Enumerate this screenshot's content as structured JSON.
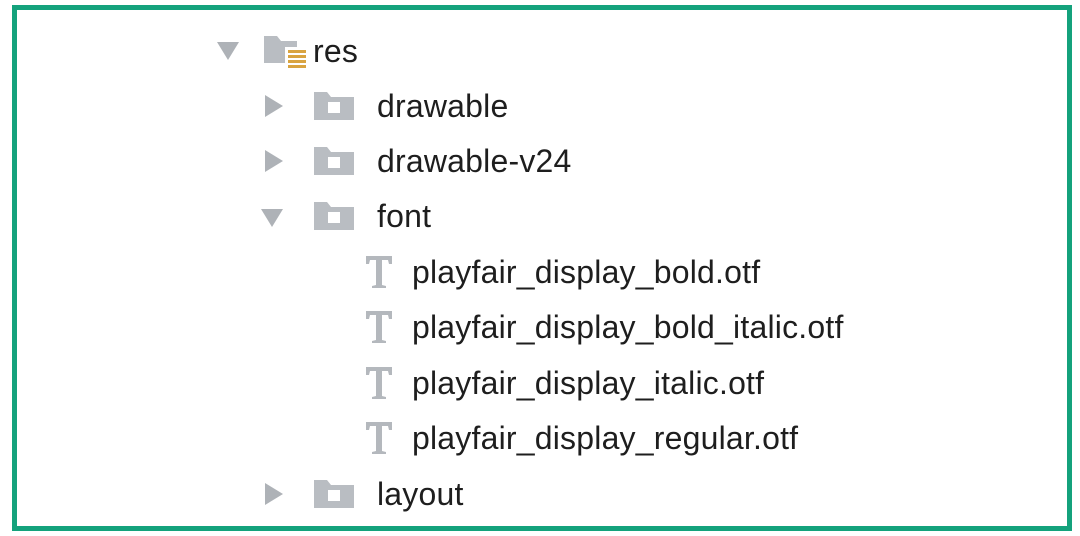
{
  "tree": {
    "root": {
      "label": "res",
      "expanded": true
    },
    "children": [
      {
        "label": "drawable",
        "expanded": false,
        "kind": "folder"
      },
      {
        "label": "drawable-v24",
        "expanded": false,
        "kind": "folder"
      },
      {
        "label": "font",
        "expanded": true,
        "kind": "folder",
        "children": [
          {
            "label": "playfair_display_bold.otf",
            "kind": "font-file"
          },
          {
            "label": "playfair_display_bold_italic.otf",
            "kind": "font-file"
          },
          {
            "label": "playfair_display_italic.otf",
            "kind": "font-file"
          },
          {
            "label": "playfair_display_regular.otf",
            "kind": "font-file"
          }
        ]
      },
      {
        "label": "layout",
        "expanded": false,
        "kind": "folder"
      }
    ]
  },
  "colors": {
    "border": "#14a27c",
    "arrow": "#aeb2b7",
    "folder": "#b9bdc2",
    "resource_accent": "#d9a441",
    "font_icon": "#b4b8bd",
    "text": "#1e1e1e"
  }
}
